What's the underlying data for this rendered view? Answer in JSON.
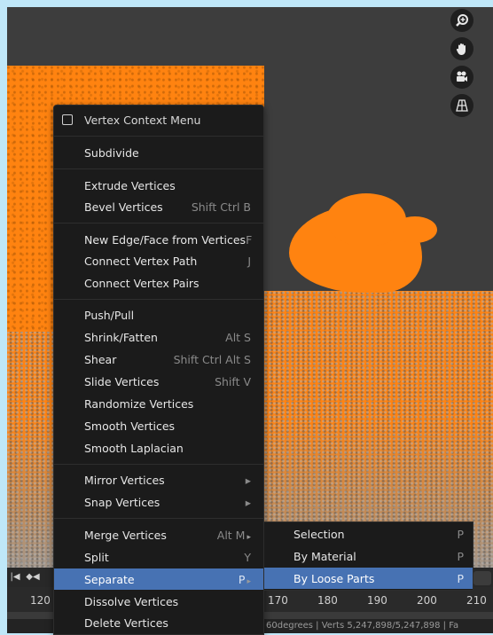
{
  "nav_icons": {
    "zoom": "zoom-icon",
    "pan": "hand-icon",
    "camera": "camera-icon",
    "grid": "perspective-grid-icon"
  },
  "context_menu": {
    "title": "Vertex Context Menu",
    "items": [
      {
        "label": "Subdivide",
        "shortcut": ""
      },
      {
        "label": "Extrude Vertices",
        "shortcut": ""
      },
      {
        "label": "Bevel Vertices",
        "shortcut": "Shift Ctrl B"
      },
      {
        "label": "New Edge/Face from Vertices",
        "shortcut": "F"
      },
      {
        "label": "Connect Vertex Path",
        "shortcut": "J"
      },
      {
        "label": "Connect Vertex Pairs",
        "shortcut": ""
      },
      {
        "label": "Push/Pull",
        "shortcut": ""
      },
      {
        "label": "Shrink/Fatten",
        "shortcut": "Alt S"
      },
      {
        "label": "Shear",
        "shortcut": "Shift Ctrl Alt S"
      },
      {
        "label": "Slide Vertices",
        "shortcut": "Shift V"
      },
      {
        "label": "Randomize Vertices",
        "shortcut": ""
      },
      {
        "label": "Smooth Vertices",
        "shortcut": ""
      },
      {
        "label": "Smooth Laplacian",
        "shortcut": ""
      },
      {
        "label": "Mirror Vertices",
        "shortcut": ""
      },
      {
        "label": "Snap Vertices",
        "shortcut": ""
      },
      {
        "label": "Merge Vertices",
        "shortcut": "Alt M"
      },
      {
        "label": "Split",
        "shortcut": "Y"
      },
      {
        "label": "Separate",
        "shortcut": "P"
      },
      {
        "label": "Dissolve Vertices",
        "shortcut": ""
      },
      {
        "label": "Delete Vertices",
        "shortcut": ""
      }
    ]
  },
  "separate_submenu": {
    "items": [
      {
        "label": "Selection",
        "shortcut": "P"
      },
      {
        "label": "By Material",
        "shortcut": "P"
      },
      {
        "label": "By Loose Parts",
        "shortcut": "P"
      }
    ]
  },
  "timeline": {
    "frame_ticks": [
      "120",
      "170",
      "180",
      "190",
      "200",
      "210"
    ],
    "status_text": "60degrees | Verts 5,247,898/5,247,898 | Fa"
  },
  "colors": {
    "accent": "#4772b3",
    "mesh": "#ff7f0e",
    "menu_bg": "#1b1b1b",
    "viewport_bg": "#3d3d3d"
  }
}
